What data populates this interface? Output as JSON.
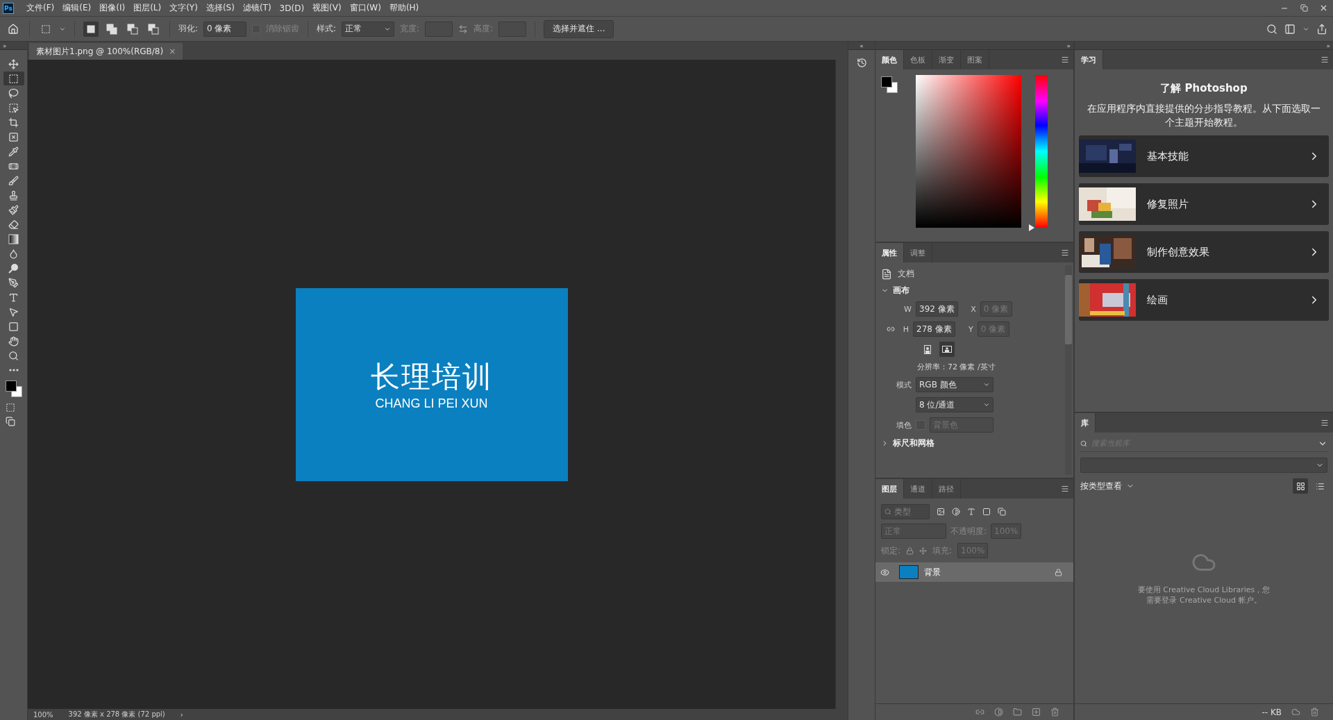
{
  "menu_bar": {
    "logo": "Ps",
    "items": [
      "文件(F)",
      "编辑(E)",
      "图像(I)",
      "图层(L)",
      "文字(Y)",
      "选择(S)",
      "滤镜(T)",
      "3D(D)",
      "视图(V)",
      "窗口(W)",
      "帮助(H)"
    ]
  },
  "options_bar": {
    "modes": [
      {
        "kind": "new",
        "selected": true
      },
      {
        "kind": "add",
        "selected": false
      },
      {
        "kind": "subtract",
        "selected": false
      },
      {
        "kind": "intersect",
        "selected": false
      }
    ],
    "feather_label": "羽化:",
    "feather_value": "0 像素",
    "anti_alias": {
      "label": "消除锯齿",
      "checked": false,
      "disabled": true
    },
    "style_label": "样式:",
    "style_value": "正常",
    "width_label": "宽度:",
    "height_label": "高度:",
    "mask_button": "选择并遮住 ..."
  },
  "tools": [
    {
      "kind": "move",
      "selected": false
    },
    {
      "kind": "marquee",
      "selected": true
    },
    {
      "kind": "lasso",
      "selected": false
    },
    {
      "kind": "object",
      "selected": false
    },
    {
      "kind": "crop",
      "selected": false
    },
    {
      "kind": "frame",
      "selected": false
    },
    {
      "kind": "eyedropper",
      "selected": false
    },
    {
      "kind": "heal",
      "selected": false
    },
    {
      "kind": "brush",
      "selected": false
    },
    {
      "kind": "stamp",
      "selected": false
    },
    {
      "kind": "history",
      "selected": false
    },
    {
      "kind": "eraser",
      "selected": false
    },
    {
      "kind": "gradient",
      "selected": false
    },
    {
      "kind": "blur",
      "selected": false
    },
    {
      "kind": "dodge",
      "selected": false
    },
    {
      "kind": "pen",
      "selected": false
    },
    {
      "kind": "type",
      "selected": false
    },
    {
      "kind": "path",
      "selected": false
    },
    {
      "kind": "shape",
      "selected": false
    },
    {
      "kind": "hand",
      "selected": false
    },
    {
      "kind": "zoom",
      "selected": false
    },
    {
      "kind": "more",
      "selected": false
    }
  ],
  "document_tab": {
    "title": "素材图片1.png @ 100%(RGB/8)",
    "close": "×"
  },
  "canvas_image": {
    "title": "长理培训",
    "subtitle": "CHANG LI PEI XUN"
  },
  "status_bar": {
    "zoom": "100%",
    "info": "392 像素 x 278 像素 (72 ppi)",
    "arrow": "›"
  },
  "panel_strips": {
    "tools": "»",
    "history": "«",
    "panels": "»",
    "learn": "»"
  },
  "color_panel": {
    "hue_slider": {
      "level": 0
    },
    "tabs": [
      {
        "label": "颜色",
        "selected": true
      },
      {
        "label": "色板",
        "selected": false
      },
      {
        "label": "渐变",
        "selected": false
      },
      {
        "label": "图案",
        "selected": false
      }
    ]
  },
  "properties_panel": {
    "tabs": [
      {
        "label": "属性",
        "selected": true
      },
      {
        "label": "调整",
        "selected": false
      }
    ],
    "doc_label": "文档",
    "canvas_section": {
      "title": "画布",
      "expanded": true,
      "w_label": "W",
      "w_value": "392 像素",
      "x_label": "X",
      "x_value": "0 像素",
      "h_label": "H",
      "h_value": "278 像素",
      "y_label": "Y",
      "y_value": "0 像素",
      "orientations": [
        {
          "kind": "portrait",
          "selected": false
        },
        {
          "kind": "landscape",
          "selected": true
        }
      ],
      "resolution": "分辨率：72 像素 /英寸",
      "mode_label": "模式",
      "mode_value": "RGB 颜色",
      "depth_value": "8 位/通道",
      "fill_label": "填色",
      "fill_value": "背景色"
    },
    "next_section": {
      "title": "标尺和网格",
      "expanded": false
    }
  },
  "layers_panel": {
    "tabs": [
      {
        "label": "图层",
        "selected": true
      },
      {
        "label": "通道",
        "selected": false
      },
      {
        "label": "路径",
        "selected": false
      }
    ],
    "filter_placeholder": "类型",
    "blend_mode": "正常",
    "opacity_label": "不透明度:",
    "opacity_value": "100%",
    "lock_label": "锁定:",
    "fill_label": "填充:",
    "fill_value": "100%",
    "layers": [
      {
        "name": "背景",
        "visible": true,
        "locked": true,
        "selected": true
      }
    ]
  },
  "learn_panel": {
    "tab": "学习",
    "title": "了解 Photoshop",
    "description": "在应用程序内直接提供的分步指导教程。从下面选取一个主题开始教程。",
    "cards": [
      {
        "label": "基本技能",
        "kind": "picture"
      },
      {
        "label": "修复照片",
        "kind": "picture"
      },
      {
        "label": "制作创意效果",
        "kind": "picture"
      },
      {
        "label": "绘画",
        "kind": "picture"
      }
    ]
  },
  "libraries_panel": {
    "tab": "库",
    "search_placeholder": "搜索当前库",
    "view_by": "按类型查看",
    "views": [
      {
        "kind": "grid",
        "selected": true
      },
      {
        "kind": "list",
        "selected": false
      }
    ],
    "message": "要使用 Creative Cloud Libraries，您需要登录 Creative Cloud 帐户。",
    "size": "-- KB"
  }
}
